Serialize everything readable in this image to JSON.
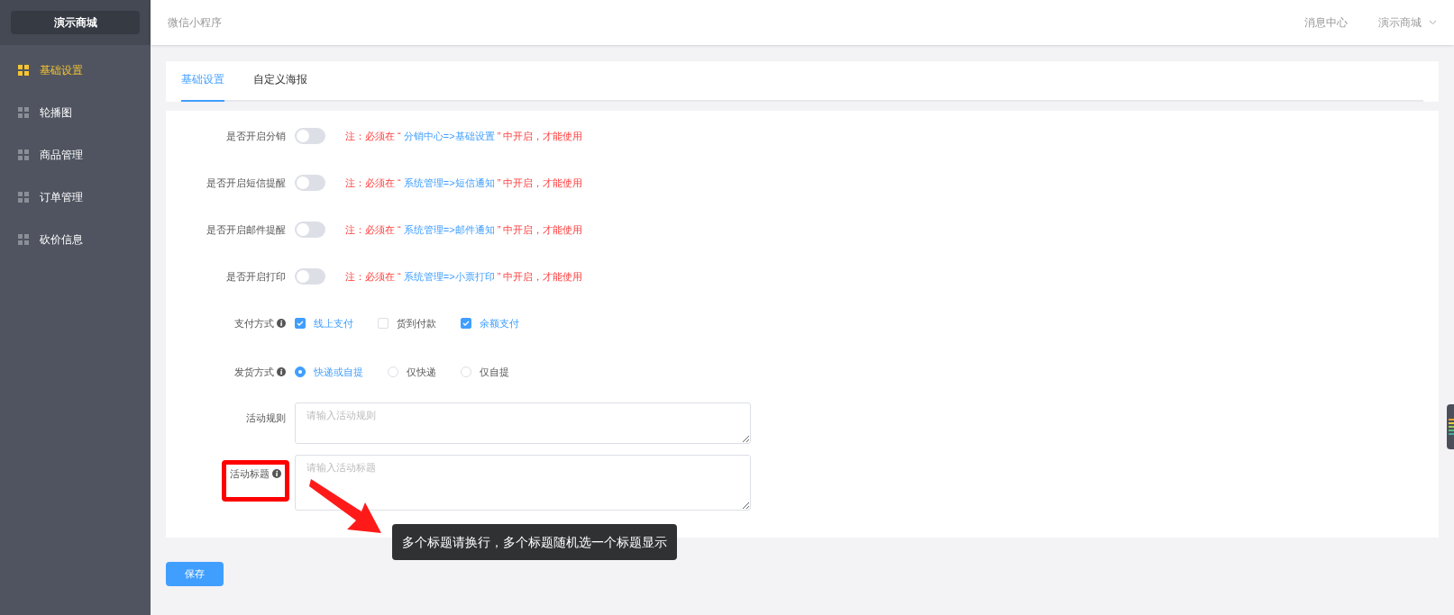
{
  "sidebar": {
    "brand": "演示商城",
    "items": [
      {
        "label": "基础设置",
        "selected": true
      },
      {
        "label": "轮播图",
        "selected": false
      },
      {
        "label": "商品管理",
        "selected": false
      },
      {
        "label": "订单管理",
        "selected": false
      },
      {
        "label": "砍价信息",
        "selected": false
      }
    ]
  },
  "header": {
    "title": "微信小程序",
    "links": [
      "消息中心"
    ],
    "user_menu": "演示商城"
  },
  "tabs": [
    {
      "label": "基础设置",
      "selected": true
    },
    {
      "label": "自定义海报",
      "selected": false
    }
  ],
  "form": {
    "rows": [
      {
        "kind": "switch",
        "label": "是否开启分销",
        "on": false,
        "note_prefix": "注：必须在 “",
        "note_path": "分销中心=>基础设置",
        "note_suffix": "” 中开启，才能使用"
      },
      {
        "kind": "switch",
        "label": "是否开启短信提醒",
        "on": false,
        "note_prefix": "注：必须在 “",
        "note_path": "系统管理=>短信通知",
        "note_suffix": "” 中开启，才能使用"
      },
      {
        "kind": "switch",
        "label": "是否开启邮件提醒",
        "on": false,
        "note_prefix": "注：必须在 “",
        "note_path": "系统管理=>邮件通知",
        "note_suffix": "” 中开启，才能使用"
      },
      {
        "kind": "switch",
        "label": "是否开启打印",
        "on": false,
        "note_prefix": "注：必须在 “",
        "note_path": "系统管理=>小票打印",
        "note_suffix": "” 中开启，才能使用"
      },
      {
        "kind": "checkboxes",
        "label": "支付方式",
        "info": true,
        "options": [
          {
            "label": "线上支付",
            "checked": true
          },
          {
            "label": "货到付款",
            "checked": false
          },
          {
            "label": "余额支付",
            "checked": true
          }
        ]
      },
      {
        "kind": "radios",
        "label": "发货方式",
        "info": true,
        "options": [
          {
            "label": "快递或自提",
            "selected": true
          },
          {
            "label": "仅快递",
            "selected": false
          },
          {
            "label": "仅自提",
            "selected": false
          }
        ]
      },
      {
        "kind": "textarea",
        "label": "活动规则",
        "info": false,
        "placeholder": "请输入活动规则"
      },
      {
        "kind": "textarea",
        "label": "活动标题",
        "info": true,
        "highlighted": true,
        "placeholder": "请输入活动标题"
      }
    ]
  },
  "tooltip": "多个标题请换行，多个标题随机选一个标题显示",
  "save_button": "保存"
}
